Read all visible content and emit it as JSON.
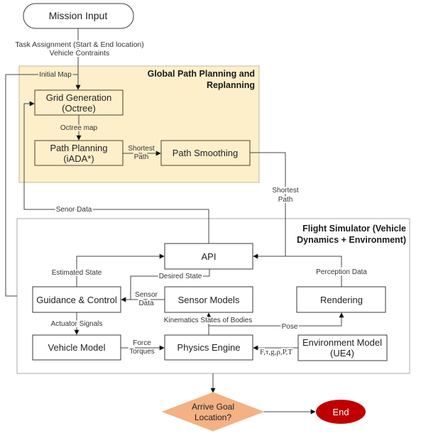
{
  "diagram": {
    "colors": {
      "global_group_fill": "#fdefc9",
      "decision_fill": "#f4b183",
      "end_fill": "#c00000"
    },
    "groups": {
      "global_path_planning": [
        "Global Path Planning and",
        "Replanning"
      ],
      "flight_simulator": [
        "Flight Simulator (Vehicle",
        "Dynamics + Environment)"
      ]
    },
    "nodes": {
      "mission_input": "Mission Input",
      "grid_generation": [
        "Grid Generation",
        "(Octree)"
      ],
      "path_planning": [
        "Path Planning",
        "(iADA*)"
      ],
      "path_smoothing": "Path Smoothing",
      "api": "API",
      "guidance_control": "Guidance & Control",
      "sensor_models": "Sensor Models",
      "rendering": "Rendering",
      "vehicle_model": "Vehicle Model",
      "physics_engine": "Physics Engine",
      "environment_model": [
        "Environment Model",
        "(UE4)"
      ],
      "decision": [
        "Arrive Goal",
        "Location?"
      ],
      "end": "End"
    },
    "edge_labels": {
      "task_assignment": [
        "Task Assignment (Start & End location)",
        "Vehicle Contraints"
      ],
      "initial_map": "Initial Map",
      "octree_map": "Octree map",
      "shortest_path_planning": [
        "Shortest",
        "Path"
      ],
      "shortest_path_output": [
        "Shortest",
        "Path"
      ],
      "senor_data": "Senor Data",
      "estimated_state": "Estimated State",
      "desired_state": "Desired State",
      "sensor_data": [
        "Sensor",
        "Data"
      ],
      "perception_data": "Perception Data",
      "actuator_signals": "Actuator Signals",
      "force_torques": [
        "Force",
        "Torques"
      ],
      "kinematics_states": "Kinematics States of Bodies",
      "pose": "Pose",
      "environment_forces": "F,τ,g,ρ,P,T"
    }
  }
}
